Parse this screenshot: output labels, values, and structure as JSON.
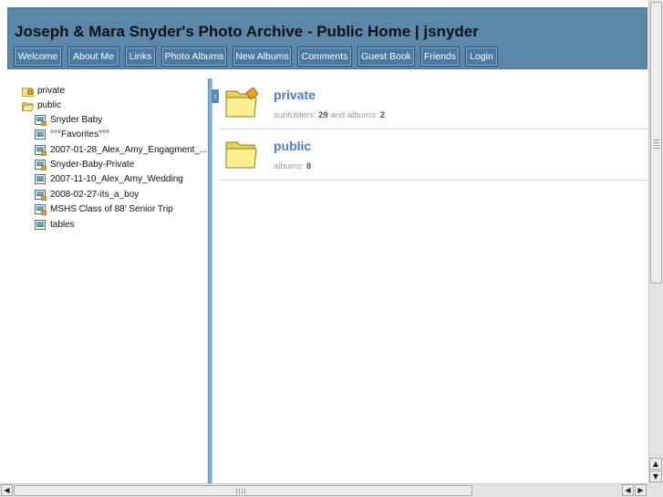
{
  "header": {
    "title": "Joseph & Mara Snyder's Photo Archive - Public Home | jsnyder",
    "nav": [
      {
        "label": "Welcome"
      },
      {
        "label": "About Me"
      },
      {
        "label": "Links"
      },
      {
        "label": "Photo Albums"
      },
      {
        "label": "New Albums"
      },
      {
        "label": "Comments"
      },
      {
        "label": "Guest Book"
      },
      {
        "label": "Friends"
      },
      {
        "label": "Login"
      }
    ]
  },
  "tree": {
    "items": [
      {
        "label": "private",
        "icon": "folder-locked-icon"
      },
      {
        "label": "public",
        "icon": "folder-open-icon"
      },
      {
        "label": "Snyder Baby",
        "icon": "album-locked-icon"
      },
      {
        "label": "°°°Favorites°°°",
        "icon": "album-icon"
      },
      {
        "label": "2007-01-28_Alex_Amy_Engagment_...",
        "icon": "album-locked-icon"
      },
      {
        "label": "Snyder-Baby-Private",
        "icon": "album-locked-icon"
      },
      {
        "label": "2007-11-10_Alex_Amy_Wedding",
        "icon": "album-icon"
      },
      {
        "label": "2008-02-27-its_a_boy",
        "icon": "album-locked-icon"
      },
      {
        "label": "MSHS Class of 88' Senior Trip",
        "icon": "album-locked-icon"
      },
      {
        "label": "tables",
        "icon": "album-icon"
      }
    ]
  },
  "content": {
    "albums": [
      {
        "title": "private",
        "icon": "folder-locked-icon",
        "meta_prefix": "subfolders:",
        "meta_count1": "29",
        "meta_mid": "and albums:",
        "meta_count2": "2"
      },
      {
        "title": "public",
        "icon": "folder-icon",
        "meta_prefix": "albums:",
        "meta_count1": "8"
      }
    ]
  },
  "scrollbars": {
    "up_arrow": "▲",
    "down_arrow": "▼",
    "left_arrow": "◀",
    "right_arrow": "▶",
    "collapse_glyph": "‹"
  },
  "colors": {
    "header_bg": "#5b87a9",
    "nav_button_bg": "#4a7aa3",
    "splitter": "#7db0d8",
    "link_blue": "#4f7cc9"
  }
}
